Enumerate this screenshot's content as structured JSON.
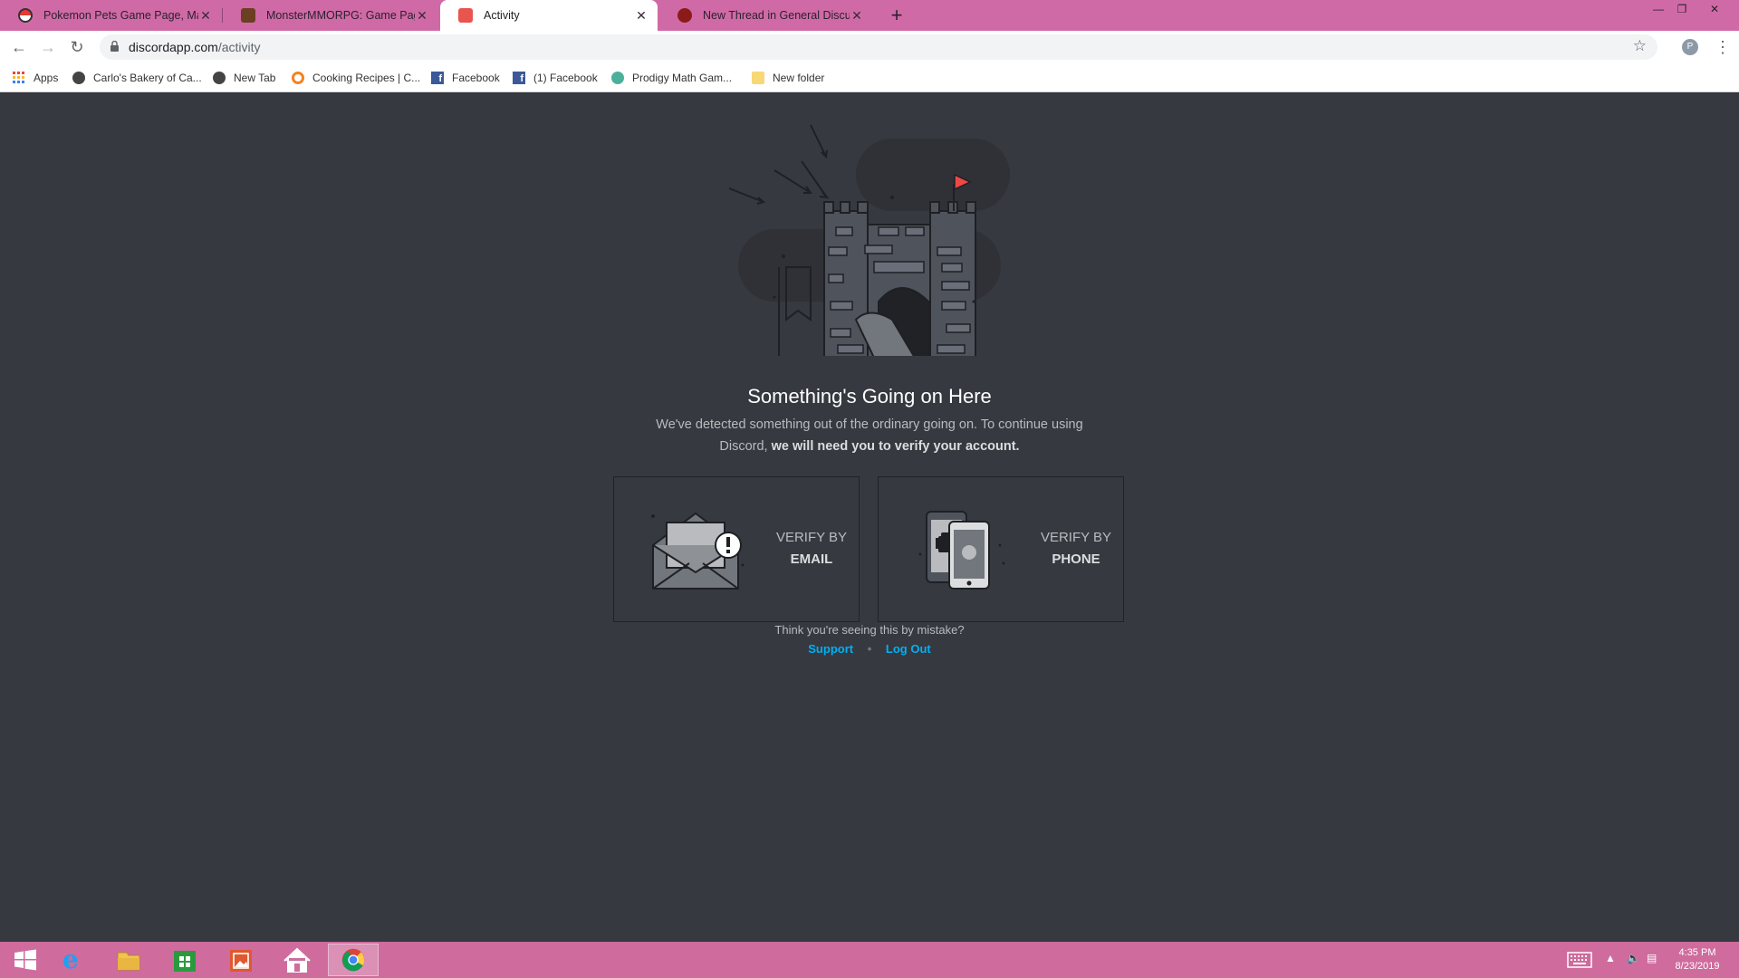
{
  "browser": {
    "tabs": [
      {
        "title": "Pokemon Pets Game Page, Map",
        "icon": "pokeball-icon",
        "active": false
      },
      {
        "title": "MonsterMMORPG: Game Page -",
        "icon": "monster-icon",
        "active": false
      },
      {
        "title": "Activity",
        "icon": "discord-icon",
        "active": true
      },
      {
        "title": "New Thread in General Discussio",
        "icon": "forum-icon",
        "active": false
      }
    ],
    "new_tab_symbol": "+",
    "url_domain": "discordapp.com",
    "url_path": "/activity",
    "profile_initial": "P",
    "bookmarks": [
      {
        "label": "Apps",
        "icon": "apps-grid-icon"
      },
      {
        "label": "Carlo's Bakery of Ca...",
        "icon": "globe-icon"
      },
      {
        "label": "New Tab",
        "icon": "globe-icon"
      },
      {
        "label": "Cooking Recipes | C...",
        "icon": "recipe-icon"
      },
      {
        "label": "Facebook",
        "icon": "facebook-icon"
      },
      {
        "label": "(1) Facebook",
        "icon": "facebook-icon"
      },
      {
        "label": "Prodigy Math Gam...",
        "icon": "prodigy-icon"
      },
      {
        "label": "New folder",
        "icon": "folder-icon"
      }
    ]
  },
  "page": {
    "title": "Something's Going on Here",
    "desc_text": "We've detected something out of the ordinary going on. To continue using Discord,",
    "desc_bold": "we will need you to verify your account.",
    "cards": [
      {
        "line1": "VERIFY BY",
        "line2": "EMAIL"
      },
      {
        "line1": "VERIFY BY",
        "line2": "PHONE"
      }
    ],
    "mistake_text": "Think you're seeing this by mistake?",
    "support_link": "Support",
    "separator": "•",
    "logout_link": "Log Out"
  },
  "taskbar": {
    "time": "4:35 PM",
    "date": "8/23/2019"
  },
  "colors": {
    "background": "#36393f",
    "tab_strip": "#d06aa6",
    "link": "#00b0f4",
    "flag": "#f04747"
  }
}
